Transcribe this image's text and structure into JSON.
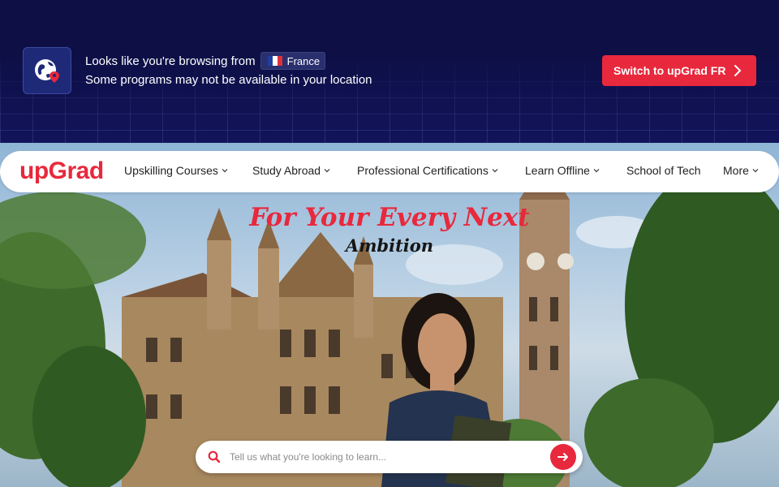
{
  "geo_banner": {
    "line1_prefix": "Looks like you're browsing from",
    "country": "France",
    "line2": "Some programs may not be available in your location",
    "switch_button_label": "Switch to upGrad FR",
    "icon": "globe-location-icon"
  },
  "nav": {
    "logo": "upGrad",
    "items": [
      {
        "label": "Upskilling Courses",
        "has_dropdown": true
      },
      {
        "label": "Study Abroad",
        "has_dropdown": true
      },
      {
        "label": "Professional Certifications",
        "has_dropdown": true
      },
      {
        "label": "Learn Offline",
        "has_dropdown": true
      },
      {
        "label": "School of Tech",
        "has_dropdown": false
      },
      {
        "label": "More",
        "has_dropdown": true
      }
    ]
  },
  "hero": {
    "headline": "For Your Every Next",
    "subheadline": "Ambition"
  },
  "search": {
    "placeholder": "Tell us what you're looking to learn...",
    "value": ""
  },
  "colors": {
    "brand_red": "#e8283c",
    "banner_navy": "#0d0f45"
  }
}
